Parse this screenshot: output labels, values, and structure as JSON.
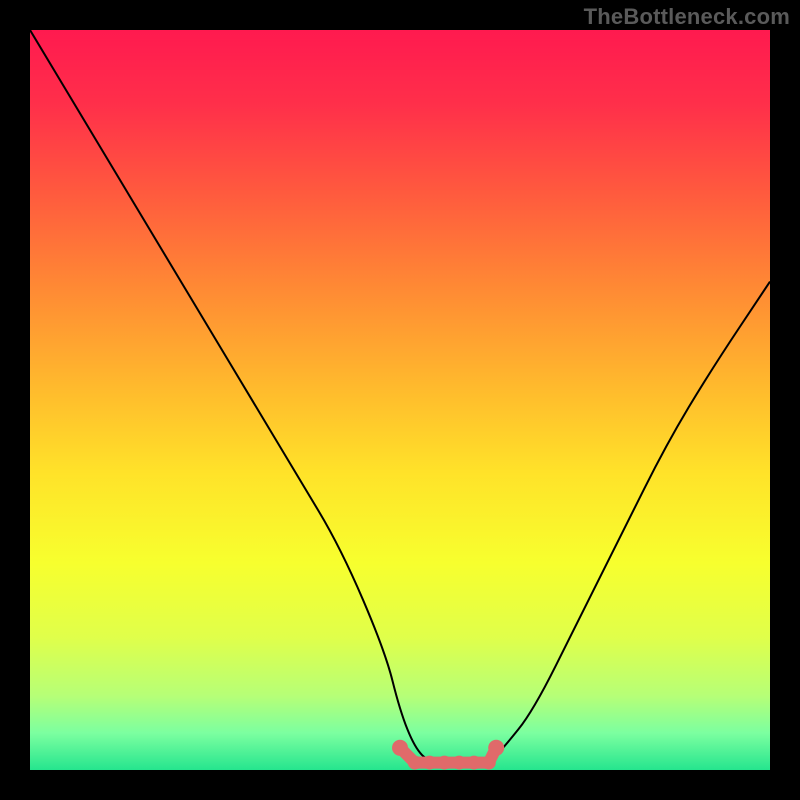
{
  "watermark": "TheBottleneck.com",
  "gradient_stops": [
    {
      "offset": 0.0,
      "color": "#ff1a4f"
    },
    {
      "offset": 0.1,
      "color": "#ff2f4a"
    },
    {
      "offset": 0.22,
      "color": "#ff5a3e"
    },
    {
      "offset": 0.35,
      "color": "#ff8a34"
    },
    {
      "offset": 0.48,
      "color": "#ffb92d"
    },
    {
      "offset": 0.6,
      "color": "#ffe329"
    },
    {
      "offset": 0.72,
      "color": "#f7ff2e"
    },
    {
      "offset": 0.82,
      "color": "#e0ff4a"
    },
    {
      "offset": 0.9,
      "color": "#b6ff77"
    },
    {
      "offset": 0.95,
      "color": "#7cffa0"
    },
    {
      "offset": 1.0,
      "color": "#25e58e"
    }
  ],
  "marker_color": "#e06a6a",
  "curve_color": "#000000",
  "chart_data": {
    "type": "line",
    "title": "",
    "xlabel": "",
    "ylabel": "",
    "xlim": [
      0,
      100
    ],
    "ylim": [
      0,
      100
    ],
    "grid": false,
    "series": [
      {
        "name": "bottleneck-curve",
        "x": [
          0,
          6,
          12,
          18,
          24,
          30,
          36,
          42,
          48,
          50,
          52,
          54,
          56,
          58,
          60,
          62,
          64,
          68,
          74,
          80,
          86,
          92,
          100
        ],
        "values": [
          100,
          90,
          80,
          70,
          60,
          50,
          40,
          30,
          16,
          8,
          3,
          1,
          1,
          1,
          1,
          1,
          3,
          8,
          20,
          32,
          44,
          54,
          66
        ]
      }
    ],
    "markers": {
      "name": "bottleneck-minimum",
      "x": [
        50,
        52,
        54,
        56,
        58,
        60,
        62,
        63
      ],
      "values": [
        3,
        1,
        1,
        1,
        1,
        1,
        1,
        3
      ]
    },
    "annotations": []
  }
}
